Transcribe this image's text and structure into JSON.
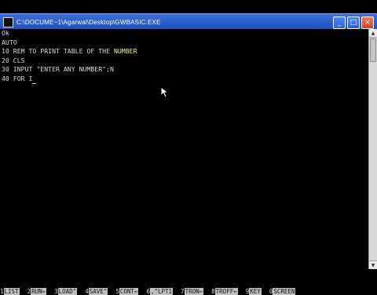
{
  "window": {
    "title": "C:\\DOCUME~1\\Agarwal\\Desktop\\GWBASIC.EXE",
    "buttons": {
      "minimize": "_",
      "maximize": "□",
      "close": "×"
    }
  },
  "console": {
    "lines": [
      "Ok",
      "AUTO",
      "10 REM TO PRINT TABLE OF THE ",
      "20 CLS",
      "30 INPUT \"ENTER ANY NUMBER\";N",
      "40 FOR I"
    ],
    "highlighted_word": "NUMBER"
  },
  "function_keys": [
    {
      "num": "1",
      "label": "LIST"
    },
    {
      "num": "2",
      "label": "RUN←"
    },
    {
      "num": "3",
      "label": "LOAD\""
    },
    {
      "num": "4",
      "label": "SAVE\""
    },
    {
      "num": "5",
      "label": "CONT←"
    },
    {
      "num": "6",
      "label": ",\"LPT1"
    },
    {
      "num": "7",
      "label": "TRON←"
    },
    {
      "num": "8",
      "label": "TROFF←"
    },
    {
      "num": "9",
      "label": "KEY"
    },
    {
      "num": "0",
      "label": "SCREEN"
    }
  ],
  "colors": {
    "titlebar": "#1f4fc4",
    "console_bg": "#000000",
    "console_text": "#d9d9d9",
    "highlight_text": "#f2f08a",
    "fkey_bg": "#bfbfbf"
  }
}
